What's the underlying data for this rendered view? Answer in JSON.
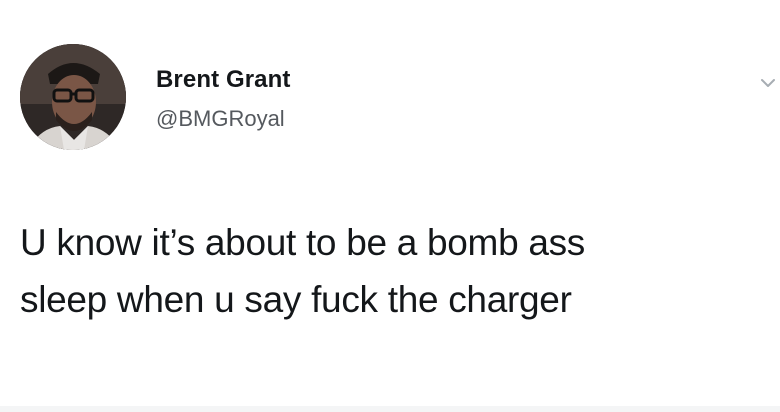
{
  "tweet": {
    "author": {
      "display_name": "Brent Grant",
      "handle": "@BMGRoyal",
      "avatar_icon": "user-avatar-photo"
    },
    "menu_icon": "chevron-down-icon",
    "text_lines": [
      "U know it’s about to be a bomb ass",
      "sleep when u say fuck the charger"
    ]
  },
  "colors": {
    "background": "#ffffff",
    "text": "#14171a",
    "handle": "#55595e"
  }
}
